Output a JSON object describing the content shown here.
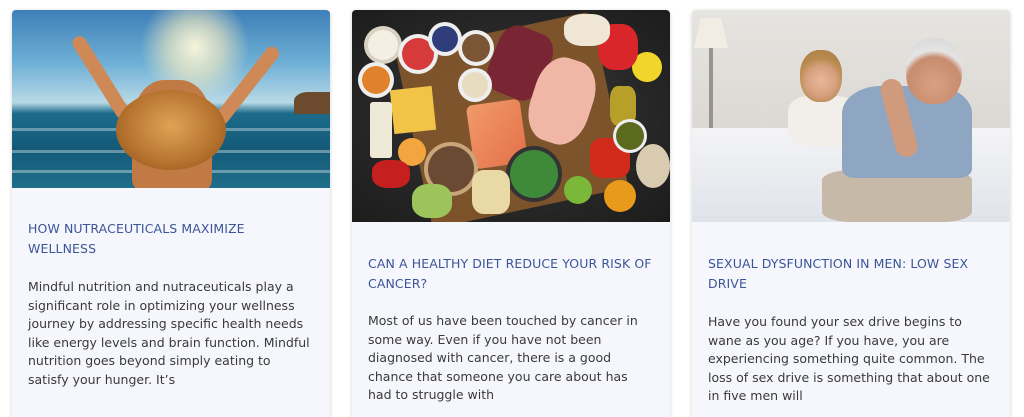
{
  "cards": [
    {
      "image_alt": "Woman with raised arms at the sea",
      "title": "HOW NUTRACEUTICALS MAXIMIZE WELLNESS",
      "excerpt": "Mindful nutrition and nutraceuticals play a significant role in optimizing your wellness journey by addressing specific health needs like energy levels and brain function. Mindful nutrition goes beyond simply eating to satisfy your hunger. It’s"
    },
    {
      "image_alt": "Assortment of healthy foods on a dark table",
      "title": "CAN A HEALTHY DIET REDUCE YOUR RISK OF CANCER?",
      "excerpt": "Most of us have been touched by cancer in some way. Even if you have not been diagnosed with cancer, there is a good chance that someone you care about has had to struggle with"
    },
    {
      "image_alt": "Worried older man sitting on bed with woman behind",
      "title": "SEXUAL DYSFUNCTION IN MEN: LOW SEX DRIVE",
      "excerpt": "Have you found your sex drive begins to wane as you age? If you have, you are experiencing something quite common. The loss of sex drive is something that about one in five men will"
    }
  ],
  "colors": {
    "title": "#3b5599",
    "excerpt": "#3a3a3a",
    "card_background": "#f6f7fc"
  }
}
